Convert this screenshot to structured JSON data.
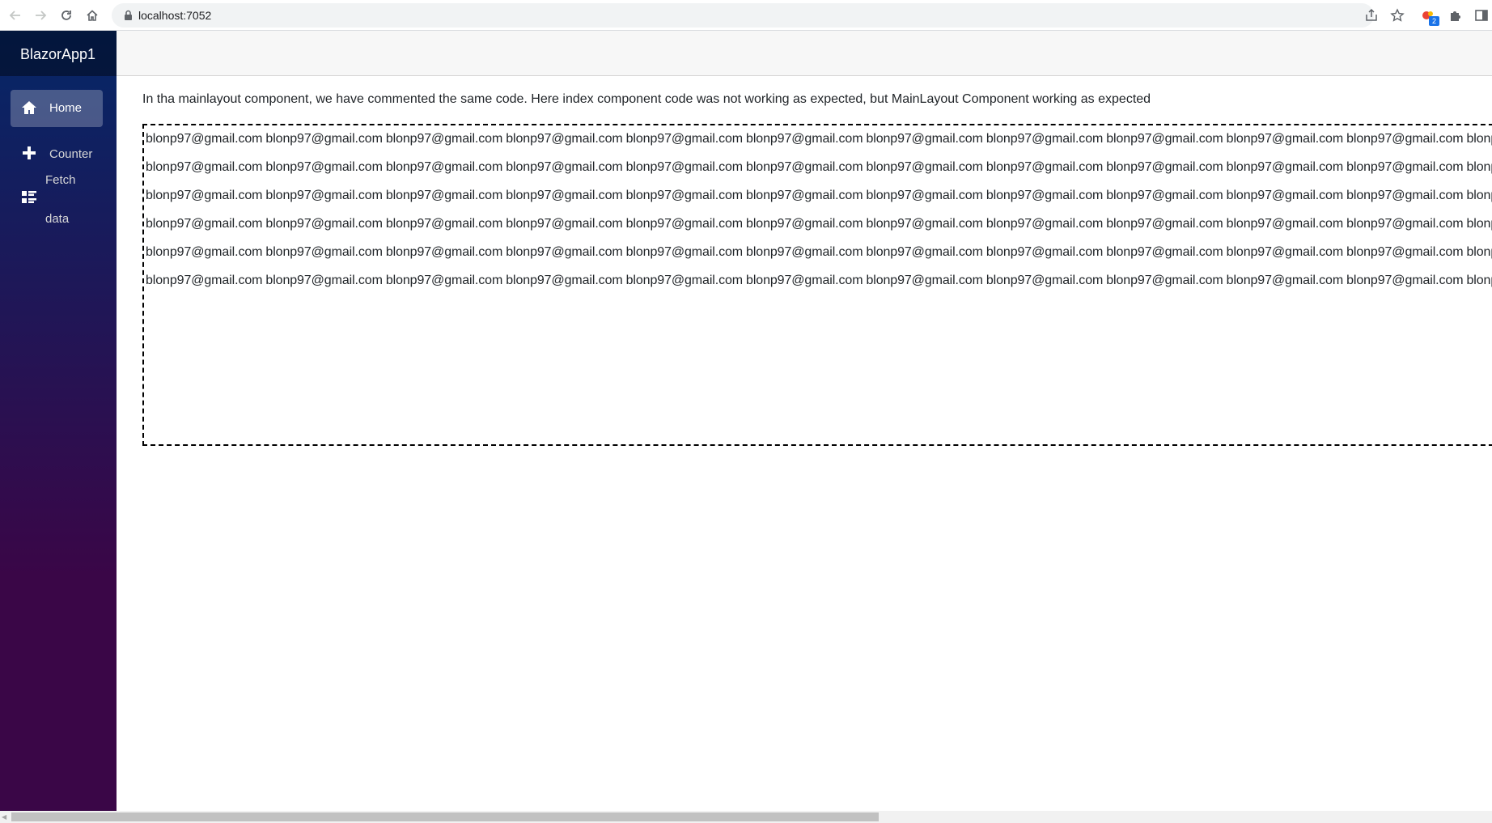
{
  "browser": {
    "url": "localhost:7052",
    "extension_badge": "2"
  },
  "app": {
    "brand": "BlazorApp1"
  },
  "sidebar": {
    "items": [
      {
        "label": "Home",
        "icon": "home-icon",
        "active": true
      },
      {
        "label": "Counter",
        "icon": "plus-icon",
        "active": false
      },
      {
        "label_line1": "Fetch",
        "label_line2": "data",
        "icon": "list-rich-icon",
        "active": false
      }
    ]
  },
  "main": {
    "intro_text": "In tha mainlayout component, we have commented the same code. Here index component code was not working as expected, but MainLayout Component working as expected",
    "email_text": "blonp97@gmail.com",
    "email_rows_visible": 6,
    "emails_per_row_visible": 11,
    "last_cut_fragment": "blonp"
  },
  "colors": {
    "sidebar_top": "#052767",
    "sidebar_bottom": "#3a0647",
    "active_nav_bg": "rgba(255,255,255,0.25)",
    "top_row_bg": "#f7f7f7"
  }
}
